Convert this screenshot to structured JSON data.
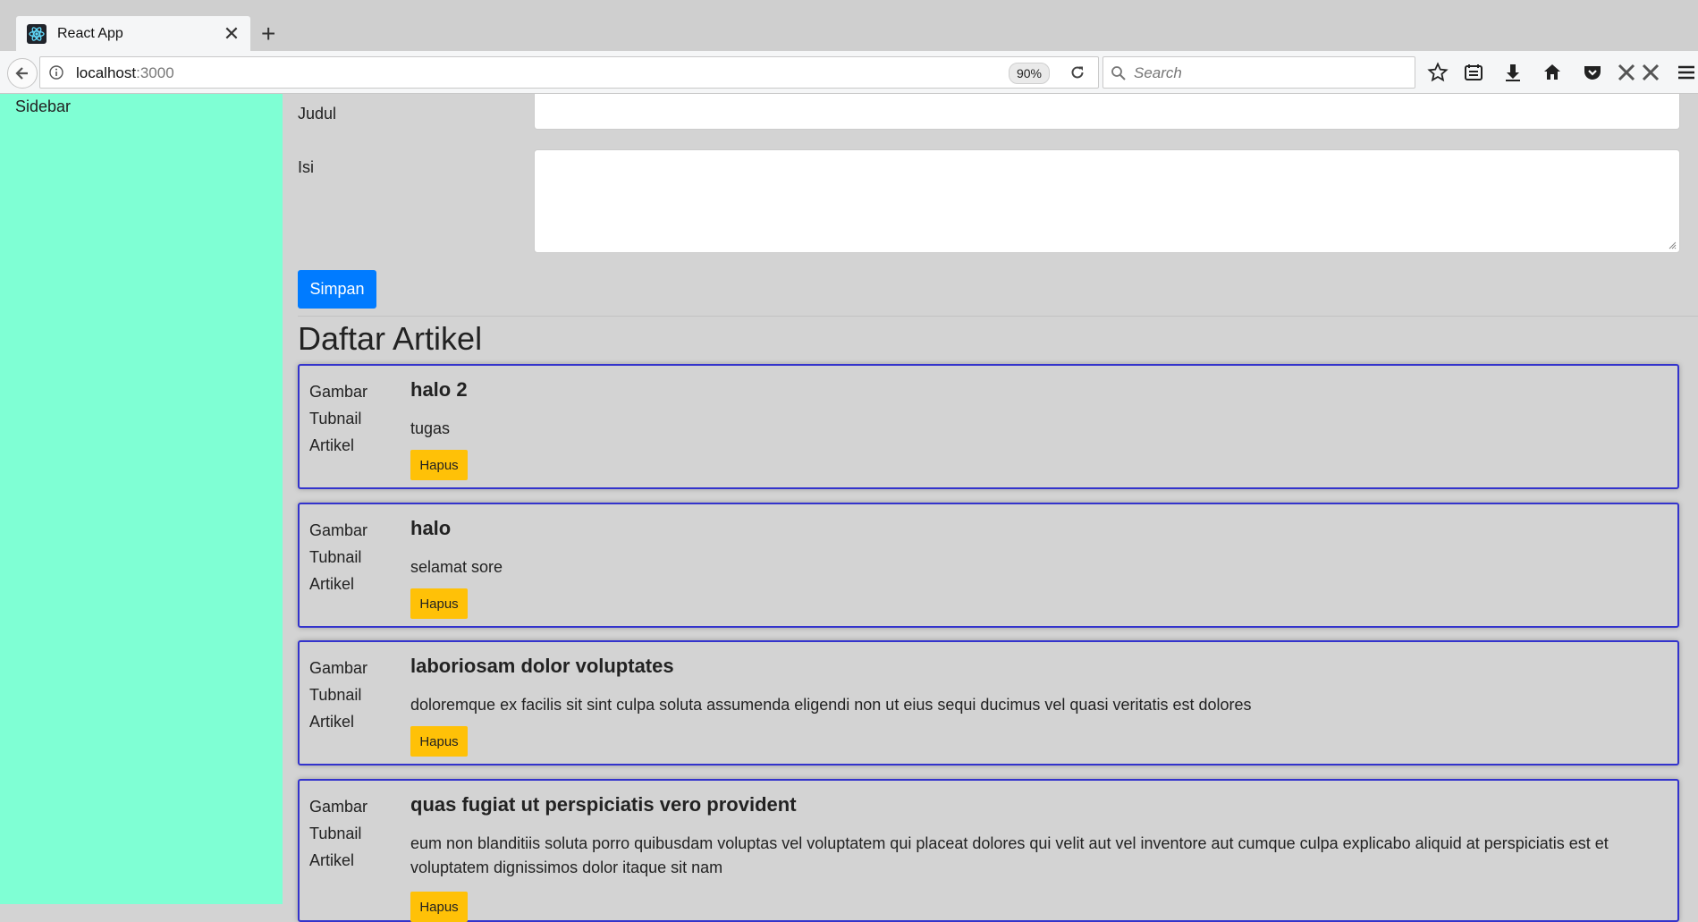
{
  "browser": {
    "tab_title": "React App",
    "url_host": "localhost",
    "url_port": ":3000",
    "zoom": "90%",
    "search_placeholder": "Search",
    "icons": [
      "star-icon",
      "reader-icon",
      "download-icon",
      "home-icon",
      "pocket-icon",
      "extension-icon",
      "extension-icon",
      "menu-icon"
    ]
  },
  "sidebar": {
    "label": "Sidebar",
    "color": "#7fffd4"
  },
  "form": {
    "judul_label": "Judul",
    "isi_label": "Isi",
    "submit_label": "Simpan",
    "submit_color": "#007bff"
  },
  "articles_section": {
    "title": "Daftar Artikel",
    "thumb_lines": [
      "Gambar",
      "Tubnail",
      "Artikel"
    ],
    "delete_label": "Hapus",
    "delete_color": "#ffc107",
    "items": [
      {
        "title": "halo 2",
        "body": "tugas"
      },
      {
        "title": "halo",
        "body": "selamat sore"
      },
      {
        "title": "laboriosam dolor voluptates",
        "body": "doloremque ex facilis sit sint culpa soluta assumenda eligendi non ut eius sequi ducimus vel quasi veritatis est dolores"
      },
      {
        "title": "quas fugiat ut perspiciatis vero provident",
        "body": "eum non blanditiis soluta porro quibusdam voluptas vel voluptatem qui placeat dolores qui velit aut vel inventore aut cumque culpa explicabo aliquid at perspiciatis est et voluptatem dignissimos dolor itaque sit nam"
      }
    ]
  }
}
